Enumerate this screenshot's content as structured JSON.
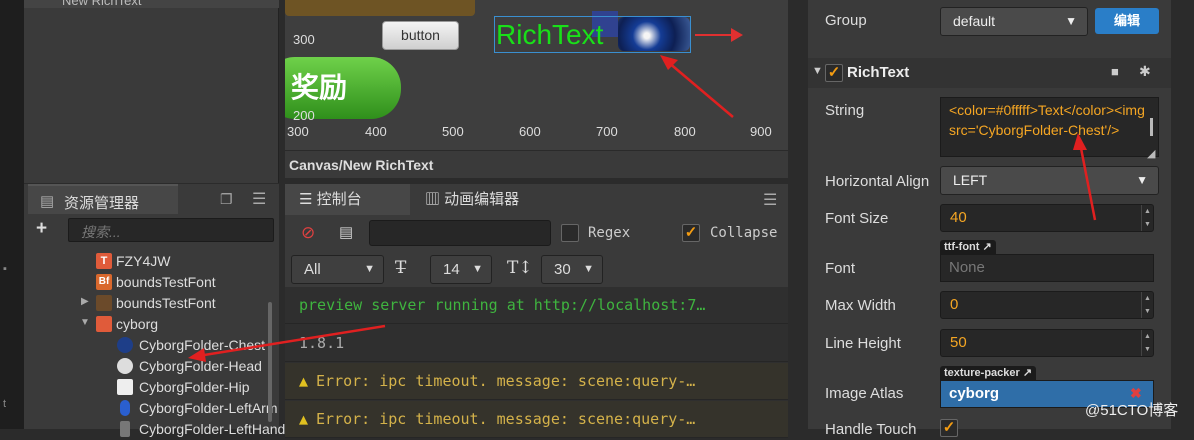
{
  "hierarchy": {
    "top_item": "New RichText"
  },
  "scene": {
    "grid_y_300": "300",
    "grid_y_200": "200",
    "x_ticks": [
      "300",
      "400",
      "500",
      "600",
      "700",
      "800",
      "900"
    ],
    "button_label": "button",
    "reward_text": "奖励",
    "richtext_label": "RichText",
    "path": "Canvas/New RichText"
  },
  "assets": {
    "tab_label": "资源管理器",
    "search_placeholder": "搜索...",
    "items": [
      {
        "label": "FZY4JW",
        "icon": "T",
        "color": "#e05b3a"
      },
      {
        "label": "boundsTestFont",
        "icon": "Bf",
        "color": "#d9682d"
      },
      {
        "label": "boundsTestFont",
        "icon": "",
        "color": "#6b4a2a"
      },
      {
        "label": "cyborg",
        "icon": "",
        "color": "#e05b3a"
      },
      {
        "label": "CyborgFolder-Chest",
        "icon": "",
        "color": "#1e3e88"
      },
      {
        "label": "CyborgFolder-Head",
        "icon": "",
        "color": "#dddddd"
      },
      {
        "label": "CyborgFolder-Hip",
        "icon": "",
        "color": "#eeeeee"
      },
      {
        "label": "CyborgFolder-LeftArm",
        "icon": "",
        "color": "#2a5fcf"
      },
      {
        "label": "CyborgFolder-LeftHand",
        "icon": "",
        "color": "#777777"
      }
    ]
  },
  "console": {
    "tab_console": "控制台",
    "tab_anim": "动画编辑器",
    "regex_label": "Regex",
    "collapse_label": "Collapse",
    "level_select": "All",
    "font_size": "14",
    "line_height": "30",
    "logs": [
      {
        "text": "preview server running at http://localhost:7…",
        "color": "#3fb43f",
        "warn": false
      },
      {
        "text": "1.8.1",
        "color": "#aaaaaa",
        "warn": false
      },
      {
        "text": "Error: ipc timeout. message: scene:query-…",
        "color": "#d4b24a",
        "warn": true
      },
      {
        "text": "Error: ipc timeout. message: scene:query-…",
        "color": "#d4b24a",
        "warn": true
      }
    ]
  },
  "inspector": {
    "group_label": "Group",
    "group_value": "default",
    "edit_button": "编辑",
    "component_title": "RichText",
    "string_label": "String",
    "string_value": "<color=#0fffff>Text</color><img src='CyborgFolder-Chest'/>",
    "halign_label": "Horizontal Align",
    "halign_value": "LEFT",
    "font_size_label": "Font Size",
    "font_size_value": "40",
    "font_label": "Font",
    "font_tag": "ttf-font",
    "font_value": "None",
    "max_width_label": "Max Width",
    "max_width_value": "0",
    "line_height_label": "Line Height",
    "line_height_value": "50",
    "atlas_label": "Image Atlas",
    "atlas_tag": "texture-packer",
    "atlas_value": "cyborg",
    "handle_touch_label": "Handle Touch"
  },
  "watermark": "@51CTO博客"
}
